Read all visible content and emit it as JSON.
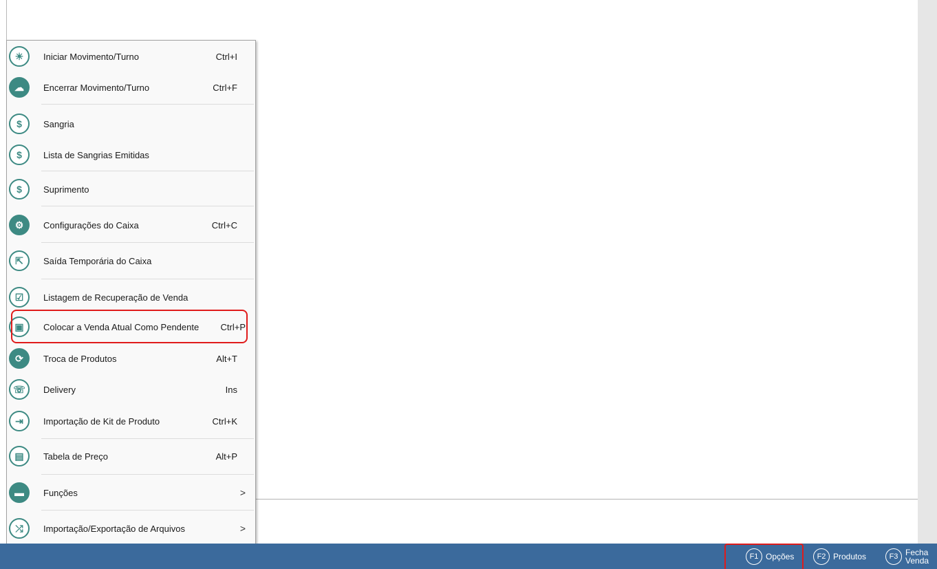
{
  "menu": {
    "items": [
      {
        "label": "Iniciar Movimento/Turno",
        "shortcut": "Ctrl+I",
        "icon": "sun-icon"
      },
      {
        "label": "Encerrar Movimento/Turno",
        "shortcut": "Ctrl+F",
        "icon": "cloud-sun-icon"
      },
      {
        "label": "Sangria",
        "shortcut": "",
        "icon": "dollar-minus-icon"
      },
      {
        "label": "Lista de Sangrias Emitidas",
        "shortcut": "",
        "icon": "dollar-minus-icon"
      },
      {
        "label": "Suprimento",
        "shortcut": "",
        "icon": "dollar-plus-icon"
      },
      {
        "label": "Configurações do Caixa",
        "shortcut": "Ctrl+C",
        "icon": "gear-icon"
      },
      {
        "label": "Saída Temporária do Caixa",
        "shortcut": "",
        "icon": "exit-icon"
      },
      {
        "label": "Listagem de Recuperação de Venda",
        "shortcut": "",
        "icon": "checklist-icon"
      },
      {
        "label": "Colocar a Venda Atual Como Pendente",
        "shortcut": "Ctrl+P",
        "icon": "register-icon"
      },
      {
        "label": "Troca de Produtos",
        "shortcut": "Alt+T",
        "icon": "swap-icon"
      },
      {
        "label": "Delivery",
        "shortcut": "Ins",
        "icon": "delivery-icon"
      },
      {
        "label": "Importação de Kit de Produto",
        "shortcut": "Ctrl+K",
        "icon": "import-icon"
      },
      {
        "label": "Tabela de Preço",
        "shortcut": "Alt+P",
        "icon": "price-table-icon"
      },
      {
        "label": "Funções",
        "shortcut": "",
        "icon": "folder-icon",
        "submenu": ">"
      },
      {
        "label": "Importação/Exportação de Arquivos",
        "shortcut": "",
        "icon": "shuffle-icon",
        "submenu": ">"
      }
    ]
  },
  "taskbar": {
    "f1": {
      "key": "F1",
      "label": "Opções"
    },
    "f2": {
      "key": "F2",
      "label": "Produtos"
    },
    "f3": {
      "key": "F3",
      "label_line1": "Fecha",
      "label_line2": "Venda"
    }
  },
  "colors": {
    "icon": "#3d8a83",
    "taskbar": "#3b6a9c",
    "highlight": "#e01b1b"
  }
}
